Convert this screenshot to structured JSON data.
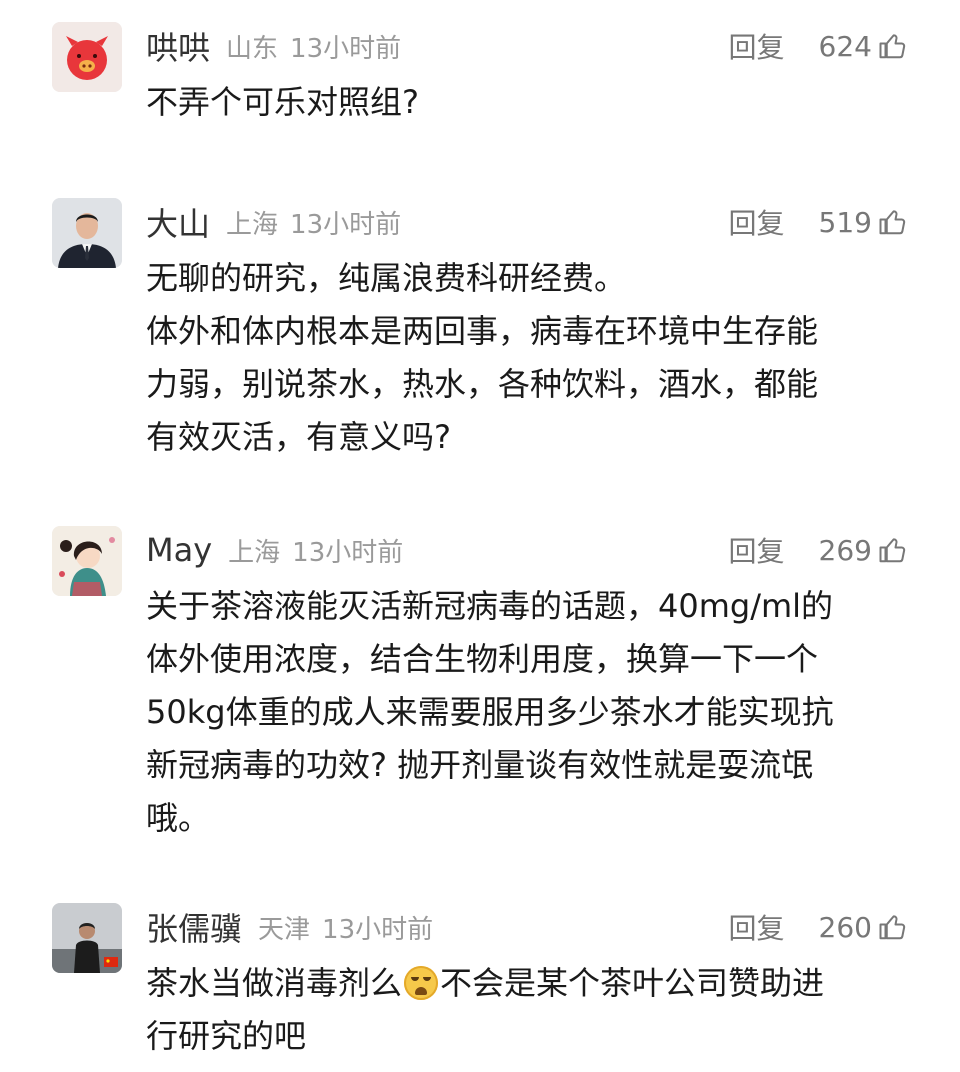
{
  "comments": [
    {
      "name": "哄哄",
      "location": "山东",
      "time": "13小时前",
      "reply": "回复",
      "likes": "624",
      "avatar_icon": "pig-face-icon",
      "lines": [
        "不弄个可乐对照组?"
      ]
    },
    {
      "name": "大山",
      "location": "上海",
      "time": "13小时前",
      "reply": "回复",
      "likes": "519",
      "avatar_icon": "man-in-suit-photo",
      "lines": [
        "无聊的研究，纯属浪费科研经费。",
        "体外和体内根本是两回事，病毒在环境中生存能",
        "力弱，别说茶水，热水，各种饮料，酒水，都能",
        "有效灭活，有意义吗?"
      ]
    },
    {
      "name": "May",
      "location": "上海",
      "time": "13小时前",
      "reply": "回复",
      "likes": "269",
      "avatar_icon": "cartoon-girl-icon",
      "lines": [
        "关于茶溶液能灭活新冠病毒的话题，40mg/ml的",
        "体外使用浓度，结合生物利用度，换算一下一个",
        "50kg体重的成人来需要服用多少茶水才能实现抗",
        "新冠病毒的功效? 抛开剂量谈有效性就是耍流氓",
        "哦。"
      ]
    },
    {
      "name": "张儒骥",
      "location": "天津",
      "time": "13小时前",
      "reply": "回复",
      "likes": "260",
      "avatar_icon": "man-outdoor-photo",
      "line1_before": "茶水当做消毒剂么",
      "emoji_icon": "crying-laughing-emoji-icon",
      "line1_after": "不会是某个茶叶公司赞助进",
      "line2": "行研究的吧"
    }
  ],
  "colors": {
    "text": "#1a1a1a",
    "name": "#333333",
    "meta": "#9a9a9a",
    "action": "#777777"
  }
}
